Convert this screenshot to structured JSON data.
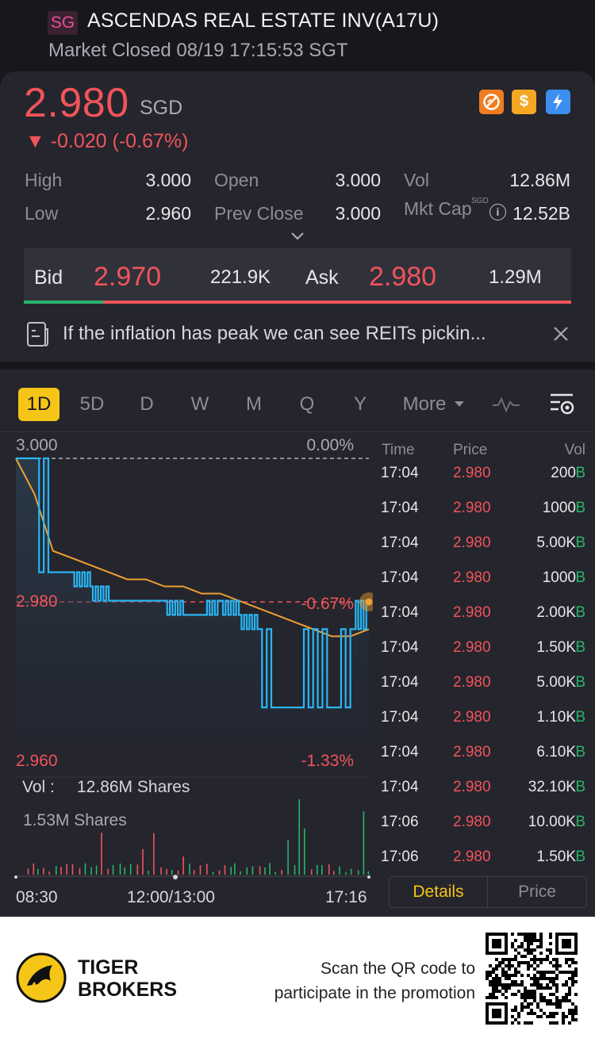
{
  "header": {
    "market_badge": "SG",
    "title": "ASCENDAS REAL ESTATE INV(A17U)",
    "market_status": "Market Closed 08/19 17:15:53 SGT"
  },
  "quote": {
    "price": "2.980",
    "currency": "SGD",
    "change": "-0.020 (-0.67%)",
    "status_icons": [
      "no-short-icon",
      "dividend-icon",
      "margin-icon"
    ]
  },
  "stats": {
    "high_label": "High",
    "high": "3.000",
    "low_label": "Low",
    "low": "2.960",
    "open_label": "Open",
    "open": "3.000",
    "prev_close_label": "Prev Close",
    "prev_close": "3.000",
    "vol_label": "Vol",
    "vol": "12.86M",
    "mkt_cap_label": "Mkt Cap",
    "mkt_cap_currency": "SGD",
    "mkt_cap": "12.52B"
  },
  "bid_ask": {
    "bid_label": "Bid",
    "bid_price": "2.970",
    "bid_size": "221.9K",
    "ask_label": "Ask",
    "ask_price": "2.980",
    "ask_size": "1.29M",
    "bid_share": 0.145
  },
  "news": {
    "text": "If the inflation has peak we can see REITs pickin..."
  },
  "chart_tabs": [
    "1D",
    "5D",
    "D",
    "W",
    "M",
    "Q",
    "Y",
    "More"
  ],
  "chart": {
    "y_top": "3.000",
    "pct_top": "0.00%",
    "y_mid": "2.980",
    "pct_mid": "-0.67%",
    "y_bottom": "2.960",
    "pct_bottom": "-1.33%",
    "vol_label": "Vol :",
    "vol_value": "12.86M Shares",
    "vol_max": "1.53M Shares",
    "x_labels": [
      "08:30",
      "12:00/13:00",
      "17:16"
    ]
  },
  "chart_data": {
    "type": "line",
    "ylim": [
      2.96,
      3.0
    ],
    "series": [
      {
        "values": [
          3.0,
          3.0,
          2.984,
          2.984,
          2.982,
          2.98,
          2.98,
          2.98,
          2.98,
          2.978,
          2.978,
          2.98,
          2.978,
          2.976,
          2.965,
          2.965,
          2.976,
          2.965,
          2.976,
          2.98
        ]
      },
      {
        "values": [
          3.0,
          2.995,
          2.987,
          2.986,
          2.985,
          2.984,
          2.983,
          2.983,
          2.982,
          2.982,
          2.981,
          2.981,
          2.98,
          2.979,
          2.978,
          2.977,
          2.976,
          2.975,
          2.975,
          2.976
        ]
      }
    ]
  },
  "time_sales": {
    "headers": {
      "time": "Time",
      "price": "Price",
      "vol": "Vol"
    },
    "rows": [
      {
        "time": "17:04",
        "price": "2.980",
        "vol": "200",
        "flag": "B"
      },
      {
        "time": "17:04",
        "price": "2.980",
        "vol": "1000",
        "flag": "B"
      },
      {
        "time": "17:04",
        "price": "2.980",
        "vol": "5.00K",
        "flag": "B"
      },
      {
        "time": "17:04",
        "price": "2.980",
        "vol": "1000",
        "flag": "B"
      },
      {
        "time": "17:04",
        "price": "2.980",
        "vol": "2.00K",
        "flag": "B"
      },
      {
        "time": "17:04",
        "price": "2.980",
        "vol": "1.50K",
        "flag": "B"
      },
      {
        "time": "17:04",
        "price": "2.980",
        "vol": "5.00K",
        "flag": "B"
      },
      {
        "time": "17:04",
        "price": "2.980",
        "vol": "1.10K",
        "flag": "B"
      },
      {
        "time": "17:04",
        "price": "2.980",
        "vol": "6.10K",
        "flag": "B"
      },
      {
        "time": "17:04",
        "price": "2.980",
        "vol": "32.10K",
        "flag": "B"
      },
      {
        "time": "17:06",
        "price": "2.980",
        "vol": "10.00K",
        "flag": "B"
      },
      {
        "time": "17:06",
        "price": "2.980",
        "vol": "1.50K",
        "flag": "B"
      }
    ],
    "details_label": "Details",
    "price_label": "Price"
  },
  "footer": {
    "brand_line1": "TIGER",
    "brand_line2": "BROKERS",
    "promo_line1": "Scan the QR code to",
    "promo_line2": "participate in the promotion"
  },
  "colors": {
    "up": "#28b36a",
    "down": "#f0545a",
    "accent": "#f5c518",
    "price_line": "#29b6f6",
    "avg_line": "#f0a030"
  }
}
